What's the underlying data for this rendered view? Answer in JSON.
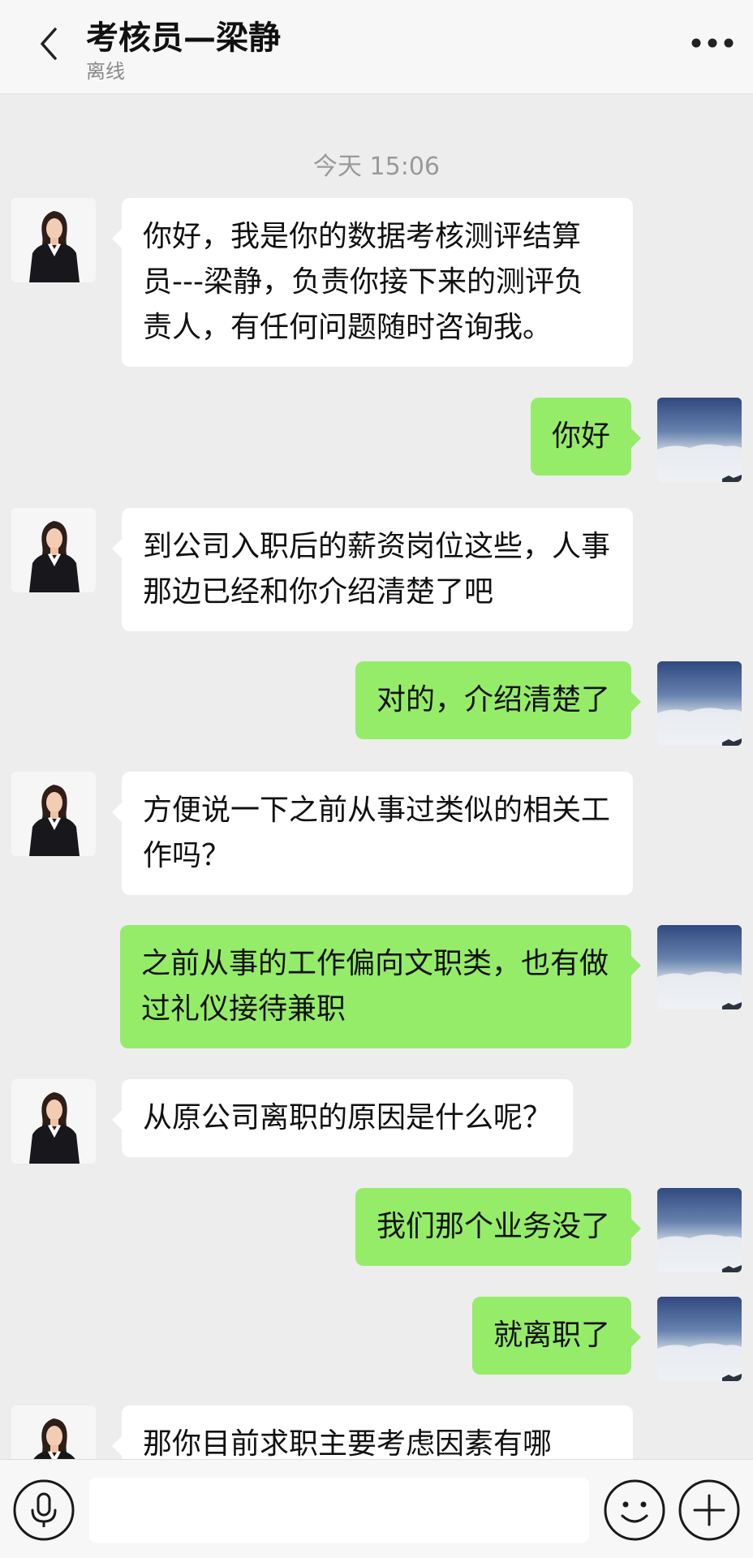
{
  "header": {
    "title": "考核员—梁静",
    "status": "离线"
  },
  "timestamp": "今天 15:06",
  "messages": [
    {
      "from": "agent",
      "text": "你好，我是你的数据考核测评结算员---梁静，负责你接下来的测评负责人，有任何问题随时咨询我。"
    },
    {
      "from": "self",
      "text": "你好"
    },
    {
      "from": "agent",
      "text": "到公司入职后的薪资岗位这些，人事那边已经和你介绍清楚了吧"
    },
    {
      "from": "self",
      "text": "对的，介绍清楚了"
    },
    {
      "from": "agent",
      "text": "方便说一下之前从事过类似的相关工作吗？"
    },
    {
      "from": "self",
      "text": "之前从事的工作偏向文职类，也有做过礼仪接待兼职"
    },
    {
      "from": "agent",
      "text": "从原公司离职的原因是什么呢？"
    },
    {
      "from": "self",
      "text": "我们那个业务没了"
    },
    {
      "from": "self",
      "text": "就离职了"
    },
    {
      "from": "agent",
      "text": "那你目前求职主要考虑因素有哪"
    }
  ],
  "input": {
    "value": ""
  },
  "icons": {
    "back": "chevron-left-icon",
    "more": "more-dots-icon",
    "voice": "microphone-icon",
    "emoji": "emoji-icon",
    "plus": "plus-icon"
  },
  "colors": {
    "background": "#ededed",
    "bubble_self": "#95ec69",
    "bubble_agent": "#ffffff"
  }
}
